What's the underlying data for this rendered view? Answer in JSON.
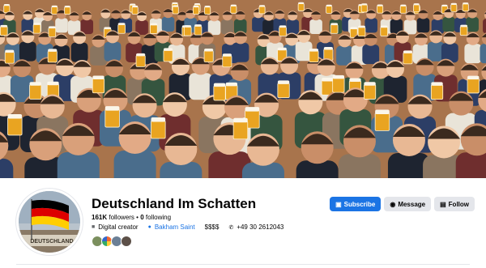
{
  "profile": {
    "name": "Deutschland Im Schatten",
    "followers": "161K",
    "followers_label": "followers",
    "following": "0",
    "following_label": "following",
    "category": "Digital creator",
    "linked_page": "Bakham Saint",
    "price_range": "$$$$",
    "phone": "+49 30 2612043",
    "avatar_sign_text": "DEUTSCHLAND"
  },
  "actions": {
    "subscribe_label": "Subscribe",
    "message_label": "Message",
    "follow_label": "Follow"
  },
  "icons": {
    "subscribe": "subscribe-icon",
    "message": "messenger-icon",
    "follow": "follow-icon",
    "category": "briefcase-icon",
    "linked_page": "page-icon",
    "phone": "phone-icon"
  },
  "colors": {
    "accent": "#1b74e4",
    "secondary_button": "#e4e6eb",
    "text": "#050505",
    "muted": "#65676b",
    "beer": "#e9a421",
    "flag_black": "#000000",
    "flag_red": "#dd0000",
    "flag_gold": "#ffce00"
  }
}
